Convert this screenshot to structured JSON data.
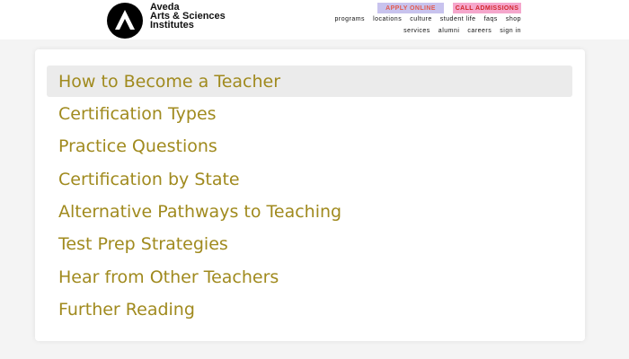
{
  "brand": {
    "line1": "Aveda",
    "line2": "Arts & Sciences",
    "line3": "Institutes"
  },
  "header": {
    "apply_label": "APPLY ONLINE",
    "call_label": "CALL ADMISSIONS",
    "nav_row1": [
      "programs",
      "locations",
      "culture",
      "student life",
      "faqs",
      "shop"
    ],
    "nav_row2": [
      "services",
      "alumni",
      "careers",
      "sign in"
    ]
  },
  "menu": {
    "items": [
      {
        "label": "How to Become a Teacher",
        "active": true
      },
      {
        "label": "Certification Types",
        "active": false
      },
      {
        "label": "Practice Questions",
        "active": false
      },
      {
        "label": "Certification by State",
        "active": false
      },
      {
        "label": "Alternative Pathways to Teaching",
        "active": false
      },
      {
        "label": "Test Prep Strategies",
        "active": false
      },
      {
        "label": "Hear from Other Teachers",
        "active": false
      },
      {
        "label": "Further Reading",
        "active": false
      }
    ]
  },
  "colors": {
    "menu_text": "#a08a1e",
    "active_bg": "#ebebeb",
    "apply_bg": "#c8c3ee",
    "call_bg": "#f5a7cc"
  },
  "icons": {
    "logo": "aveda-a-logo-icon"
  }
}
